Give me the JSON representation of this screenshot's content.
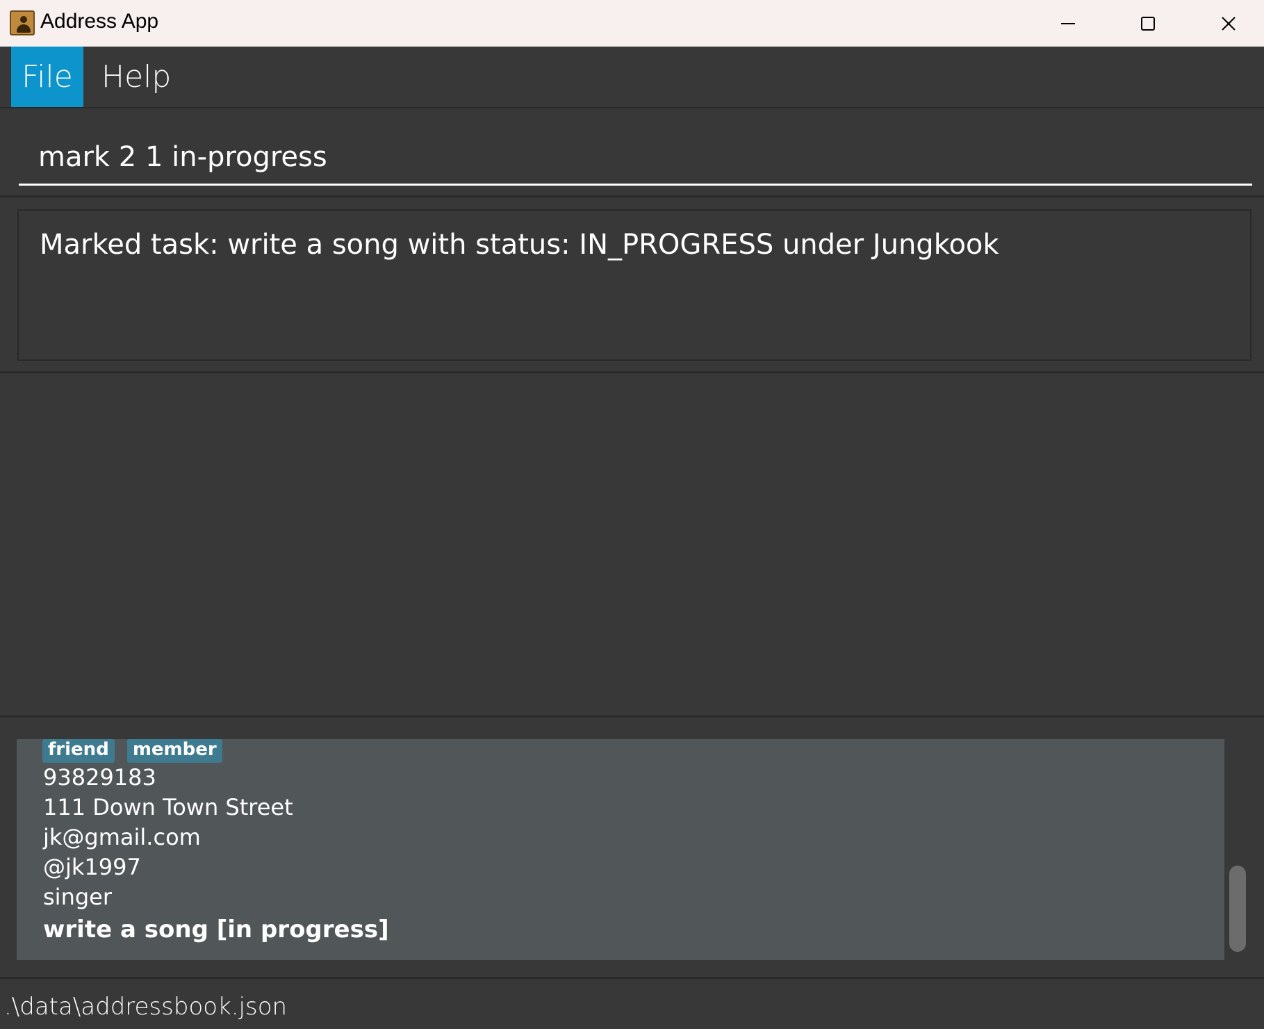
{
  "window": {
    "title": "Address App",
    "icon": "address-book-icon"
  },
  "menu": {
    "items": [
      {
        "label": "File",
        "active": true
      },
      {
        "label": "Help",
        "active": false
      }
    ]
  },
  "command": {
    "value": "mark 2 1 in-progress"
  },
  "result": {
    "message": "Marked task: write a song with status: IN_PROGRESS under Jungkook"
  },
  "person": {
    "tags": [
      "friend",
      "member"
    ],
    "phone": "93829183",
    "address": "111 Down Town Street",
    "email": "jk@gmail.com",
    "handle": "@jk1997",
    "role": "singer",
    "task": "write a song [in progress]"
  },
  "status": {
    "file_path": ".\\data\\addressbook.json"
  },
  "colors": {
    "accent": "#0e94cc",
    "background": "#383838",
    "card": "#515658",
    "tag": "#3e7b91"
  }
}
